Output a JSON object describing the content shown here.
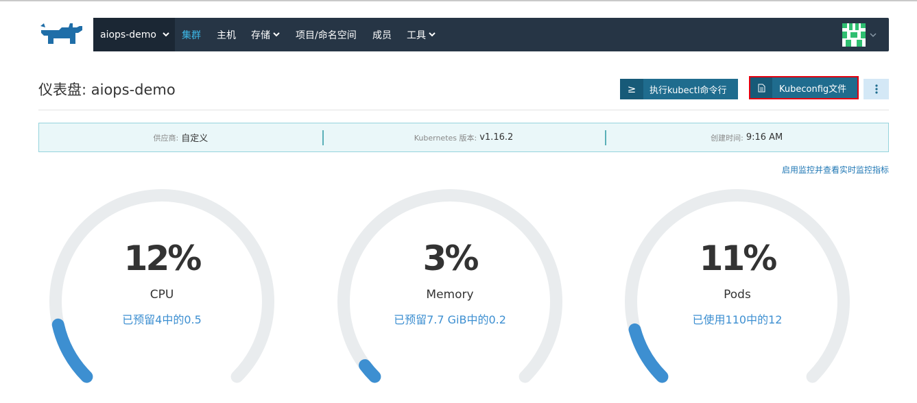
{
  "colors": {
    "navbar": "#263545",
    "accent": "#3db8e8",
    "button": "#1f6c8e",
    "highlight_border": "#e3000f",
    "gauge_track": "#e9ecee",
    "gauge_fill": "#3d8fd1"
  },
  "header": {
    "logo_icon": "rancher-logo-icon",
    "cluster": "aiops-demo",
    "nav": [
      {
        "label": "集群",
        "active": true,
        "dropdown": false
      },
      {
        "label": "主机",
        "active": false,
        "dropdown": false
      },
      {
        "label": "存储",
        "active": false,
        "dropdown": true
      },
      {
        "label": "项目/命名空间",
        "active": false,
        "dropdown": false
      },
      {
        "label": "成员",
        "active": false,
        "dropdown": false
      },
      {
        "label": "工具",
        "active": false,
        "dropdown": true
      }
    ],
    "avatar_icon": "user-avatar-icon"
  },
  "page": {
    "title": "仪表盘: aiops-demo",
    "kubectl_button": "执行kubectl命令行",
    "kubeconfig_button": "Kubeconfig文件",
    "more_icon": "vertical-dots-icon"
  },
  "info": {
    "provider_key": "供应商:",
    "provider_val": "自定义",
    "k8s_key": "Kubernetes 版本:",
    "k8s_val": "v1.16.2",
    "created_key": "创建时间:",
    "created_val": "9:16 AM"
  },
  "monitor_link": "启用监控并查看实时监控指标",
  "gauges": [
    {
      "percent": "12%",
      "fraction": 0.12,
      "label": "CPU",
      "sub": "已预留4中的0.5"
    },
    {
      "percent": "3%",
      "fraction": 0.03,
      "label": "Memory",
      "sub": "已预留7.7 GiB中的0.2"
    },
    {
      "percent": "11%",
      "fraction": 0.11,
      "label": "Pods",
      "sub": "已使用110中的12"
    }
  ]
}
